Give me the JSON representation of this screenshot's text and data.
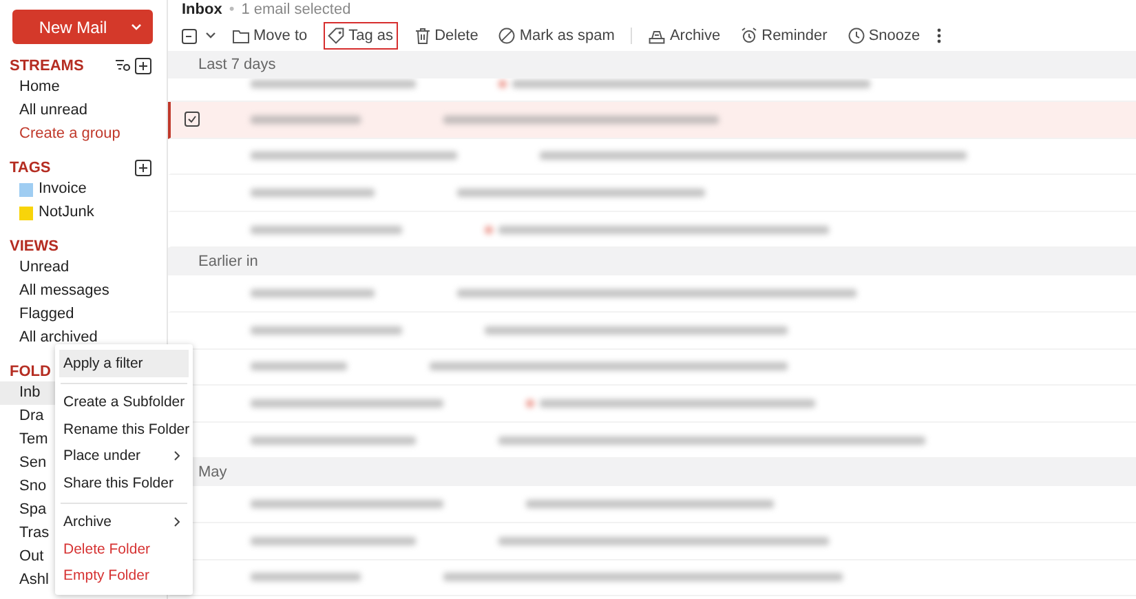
{
  "new_mail": {
    "label": "New Mail"
  },
  "sidebar": {
    "sections": [
      {
        "title": "STREAMS",
        "items": [
          {
            "label": "Home",
            "kind": "item",
            "selected": false
          },
          {
            "label": "All unread",
            "kind": "item",
            "selected": false
          },
          {
            "label": "Create a group",
            "kind": "link",
            "selected": false
          }
        ]
      },
      {
        "title": "TAGS",
        "items": [
          {
            "label": "Invoice",
            "kind": "tag",
            "color": "#9fcdf2",
            "selected": false
          },
          {
            "label": "NotJunk",
            "kind": "tag",
            "color": "#f8d40a",
            "selected": false
          }
        ]
      },
      {
        "title": "VIEWS",
        "items": [
          {
            "label": "Unread",
            "kind": "item",
            "selected": false
          },
          {
            "label": "All messages",
            "kind": "item",
            "selected": false
          },
          {
            "label": "Flagged",
            "kind": "item",
            "selected": false
          },
          {
            "label": "All archived",
            "kind": "item",
            "selected": false
          }
        ]
      },
      {
        "title": "FOLD",
        "items": [
          {
            "label": "Inb",
            "kind": "item",
            "selected": true
          },
          {
            "label": "Dra",
            "kind": "item",
            "selected": false
          },
          {
            "label": "Tem",
            "kind": "item",
            "selected": false
          },
          {
            "label": "Sen",
            "kind": "item",
            "selected": false
          },
          {
            "label": "Sno",
            "kind": "item",
            "selected": false
          },
          {
            "label": "Spa",
            "kind": "item",
            "selected": false
          },
          {
            "label": "Tras",
            "kind": "item",
            "selected": false
          },
          {
            "label": "Out",
            "kind": "item",
            "selected": false
          },
          {
            "label": "Ashl",
            "kind": "item",
            "selected": false
          }
        ]
      }
    ]
  },
  "header": {
    "folder": "Inbox",
    "separator": "•",
    "selection": "1 email selected"
  },
  "toolbar": [
    {
      "kind": "select"
    },
    {
      "kind": "button",
      "label": "Move to",
      "highlighted": false
    },
    {
      "kind": "button",
      "label": "Tag as",
      "highlighted": true
    },
    {
      "kind": "button",
      "label": "Delete",
      "highlighted": false
    },
    {
      "kind": "button",
      "label": "Mark as spam",
      "highlighted": false
    },
    {
      "kind": "separator"
    },
    {
      "kind": "button",
      "label": "Archive",
      "highlighted": false
    },
    {
      "kind": "button",
      "label": "Reminder",
      "highlighted": false
    },
    {
      "kind": "button",
      "label": "Snooze",
      "highlighted": false
    },
    {
      "kind": "more"
    }
  ],
  "groups": [
    {
      "label": "Last 7 days",
      "rows": [
        {
          "selected": false,
          "tagged": true
        },
        {
          "selected": true,
          "tagged": false
        },
        {
          "selected": false,
          "tagged": false
        },
        {
          "selected": false,
          "tagged": false
        },
        {
          "selected": false,
          "tagged": true
        }
      ]
    },
    {
      "label": "Earlier in",
      "rows": [
        {
          "selected": false,
          "tagged": false
        },
        {
          "selected": false,
          "tagged": false
        },
        {
          "selected": false,
          "tagged": false
        },
        {
          "selected": false,
          "tagged": true
        },
        {
          "selected": false,
          "tagged": false
        }
      ]
    },
    {
      "label": "May",
      "rows": [
        {
          "selected": false,
          "tagged": false
        },
        {
          "selected": false,
          "tagged": false
        },
        {
          "selected": false,
          "tagged": false
        }
      ]
    }
  ],
  "context_menu": {
    "sections": [
      [
        {
          "label": "Apply a filter",
          "highlighted": true,
          "submenu": false,
          "danger": false
        }
      ],
      [
        {
          "label": "Create a Subfolder",
          "highlighted": false,
          "submenu": false,
          "danger": false
        },
        {
          "label": "Rename this Folder",
          "highlighted": false,
          "submenu": false,
          "danger": false
        },
        {
          "label": "Place under",
          "highlighted": false,
          "submenu": true,
          "danger": false
        },
        {
          "label": "Share this Folder",
          "highlighted": false,
          "submenu": false,
          "danger": false
        }
      ],
      [
        {
          "label": "Archive",
          "highlighted": false,
          "submenu": true,
          "danger": false
        },
        {
          "label": "Delete Folder",
          "highlighted": false,
          "submenu": false,
          "danger": true
        },
        {
          "label": "Empty Folder",
          "highlighted": false,
          "submenu": false,
          "danger": true
        }
      ]
    ]
  }
}
